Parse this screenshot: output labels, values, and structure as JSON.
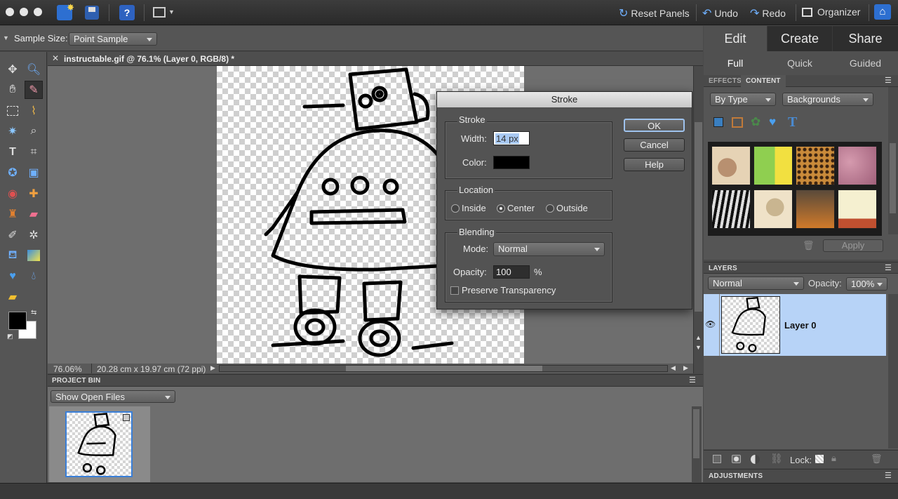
{
  "topbar": {
    "reset_panels": "Reset Panels",
    "undo": "Undo",
    "redo": "Redo",
    "organizer": "Organizer"
  },
  "options": {
    "sample_size_label": "Sample Size:",
    "sample_size_value": "Point Sample"
  },
  "document": {
    "tab_title": "instructable.gif @ 76.1% (Layer 0, RGB/8) *",
    "zoom": "76.06%",
    "doc_size": "20.28 cm x 19.97 cm (72 ppi)"
  },
  "project_bin": {
    "title": "PROJECT BIN",
    "filter": "Show Open Files"
  },
  "right_panel": {
    "main_tabs": [
      "Edit",
      "Create",
      "Share"
    ],
    "sub_tabs": [
      "Full",
      "Quick",
      "Guided"
    ],
    "effects_tab": "EFFECTS",
    "content_tab": "CONTENT",
    "by_type": "By Type",
    "category": "Backgrounds",
    "apply": "Apply",
    "layers_title": "LAYERS",
    "blend_mode": "Normal",
    "opacity_label": "Opacity:",
    "opacity_value": "100%",
    "layer_name": "Layer 0",
    "lock_label": "Lock:",
    "adjustments_title": "ADJUSTMENTS"
  },
  "dialog": {
    "title": "Stroke",
    "stroke_group": "Stroke",
    "width_label": "Width:",
    "width_value": "14 px",
    "color_label": "Color:",
    "stroke_color": "#000000",
    "location_group": "Location",
    "inside": "Inside",
    "center": "Center",
    "outside": "Outside",
    "blending_group": "Blending",
    "mode_label": "Mode:",
    "mode_value": "Normal",
    "opacity_label": "Opacity:",
    "opacity_value": "100",
    "percent": "%",
    "preserve": "Preserve Transparency",
    "ok": "OK",
    "cancel": "Cancel",
    "help": "Help"
  },
  "colors": {
    "accent_blue": "#6fb0ff",
    "selected_layer": "#b7d3f7"
  }
}
